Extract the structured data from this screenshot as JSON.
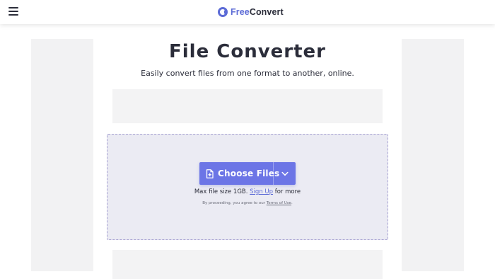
{
  "header": {
    "menu_icon": "hamburger-menu-icon",
    "logo_icon": "freeconvert-logo-icon",
    "logo_text_free": "Free",
    "logo_text_convert": "Convert",
    "brand_color": "#5c6bd6"
  },
  "main": {
    "title": "File Converter",
    "subtitle": "Easily convert files from one format to another, online."
  },
  "upload": {
    "choose_icon": "file-plus-icon",
    "choose_label": "Choose Files",
    "dropdown_icon": "chevron-down-icon",
    "max_size_prefix": "Max file size 1GB.",
    "sign_up_label": "Sign Up",
    "max_size_suffix": "for more",
    "terms_prefix": "By proceeding, you agree to our",
    "terms_link": "Terms of Use",
    "terms_suffix": ".",
    "button_color": "#6c75e6",
    "dropzone_color": "#ebebf3"
  }
}
